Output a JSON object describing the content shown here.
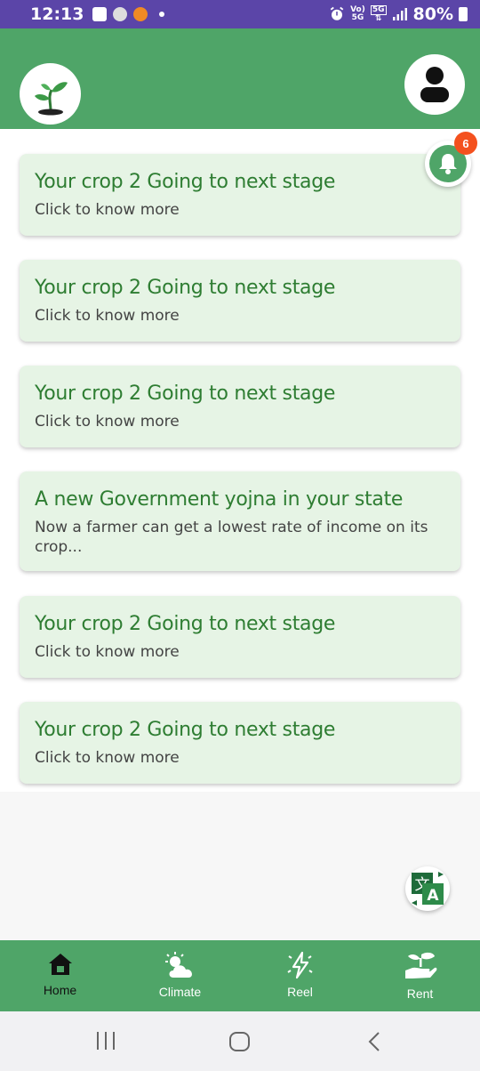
{
  "status_bar": {
    "time": "12:13",
    "battery": "80%",
    "net_top": "Vo)",
    "net_bottom": "5G",
    "net_5g": "5G"
  },
  "notifications": {
    "badge_count": "6",
    "cards": [
      {
        "title": "Your crop 2 Going to next stage",
        "subtitle": "Click to know more"
      },
      {
        "title": "Your crop 2 Going to next stage",
        "subtitle": "Click to know more"
      },
      {
        "title": "Your crop 2 Going to next stage",
        "subtitle": "Click to know more"
      },
      {
        "title": "A new Government yojna in your state",
        "subtitle": "Now a farmer can get a lowest rate of income on its crop..."
      },
      {
        "title": "Your crop 2 Going to next stage",
        "subtitle": "Click to know more"
      },
      {
        "title": "Your crop 2 Going to next stage",
        "subtitle": "Click to know more"
      }
    ]
  },
  "bottom_nav": {
    "items": [
      {
        "label": "Home",
        "icon": "home-icon",
        "active": true
      },
      {
        "label": "Climate",
        "icon": "cloud-sun-icon",
        "active": false
      },
      {
        "label": "Reel",
        "icon": "lightning-icon",
        "active": false
      },
      {
        "label": "Rent",
        "icon": "hand-plant-icon",
        "active": false
      }
    ]
  },
  "colors": {
    "primary": "#4fa568",
    "card_bg": "#e6f4e5",
    "title": "#2e7d32",
    "badge": "#f4511e",
    "status_bar": "#5b45a8"
  }
}
